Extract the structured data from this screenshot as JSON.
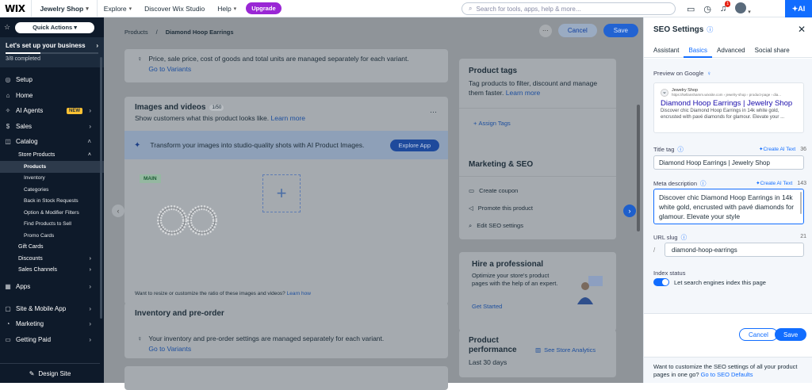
{
  "topbar": {
    "logo": "WIX",
    "site_name": "Jewelry Shop",
    "explore": "Explore",
    "discover": "Discover Wix Studio",
    "help": "Help",
    "upgrade": "Upgrade",
    "search_placeholder": "Search for tools, apps, help & more...",
    "notification_count": "1",
    "ai_label": "AI"
  },
  "sidebar": {
    "quick_actions": "Quick Actions",
    "setup_title": "Let's set up your business",
    "setup_progress_fraction": 0.375,
    "setup_status": "3/8 completed",
    "items": [
      {
        "label": "Setup",
        "icon": "setup-icon"
      },
      {
        "label": "Home",
        "icon": "home-icon"
      },
      {
        "label": "AI Agents",
        "icon": "ai-agents-icon",
        "badge": "NEW"
      },
      {
        "label": "Sales",
        "icon": "sales-icon"
      },
      {
        "label": "Catalog",
        "icon": "catalog-icon"
      }
    ],
    "catalog_sub": {
      "store_products": "Store Products",
      "store_children": [
        "Products",
        "Inventory",
        "Categories",
        "Back in Stock Requests",
        "Option & Modifier Filters",
        "Find Products to Sell",
        "Promo Cards"
      ],
      "gift_cards": "Gift Cards",
      "discounts": "Discounts",
      "sales_channels": "Sales Channels"
    },
    "bottom_items": [
      {
        "label": "Apps"
      },
      {
        "label": "Site & Mobile App"
      },
      {
        "label": "Marketing"
      },
      {
        "label": "Getting Paid"
      }
    ],
    "design_site": "Design Site"
  },
  "main": {
    "breadcrumb": [
      "Products",
      "Diamond Hoop Earrings"
    ],
    "cancel": "Cancel",
    "save": "Save",
    "variants_note": "Price, sale price, cost of goods and total units are managed separately for each variant.",
    "go_to_variants": "Go to Variants",
    "images_title": "Images and videos",
    "images_count": "1/50",
    "images_sub": "Show customers what this product looks like.",
    "learn_more": "Learn more",
    "ai_banner": "Transform your images into studio-quality shots with AI Product Images.",
    "explore_app": "Explore App",
    "main_badge": "MAIN",
    "resize_note": "Want to resize or customize the ratio of these images and videos?",
    "learn_how": "Learn how",
    "inventory_title": "Inventory and pre-order",
    "inventory_note": "Your inventory and pre-order settings are managed separately for each variant.",
    "product_tags_title": "Product tags",
    "product_tags_sub": "Tag products to filter, discount and manage them faster.",
    "assign_tags": "Assign Tags",
    "marketing_title": "Marketing & SEO",
    "marketing_items": [
      "Create coupon",
      "Promote this product",
      "Edit SEO settings"
    ],
    "hire_title": "Hire a professional",
    "hire_sub": "Optimize your store's product pages with the help of an expert.",
    "get_started": "Get Started",
    "perf_title_1": "Product",
    "perf_title_2": "performance",
    "perf_sub": "Last 30 days",
    "see_analytics": "See Store Analytics"
  },
  "panel": {
    "title": "SEO Settings",
    "tabs": [
      "Assistant",
      "Basics",
      "Advanced",
      "Social share"
    ],
    "active_tab": "Basics",
    "preview_label": "Preview on Google",
    "preview": {
      "site": "Jewelry Shop",
      "url": "https://kellanshamm.wixsite.com › jewelry-shop › product-page › dia...",
      "headline": "Diamond Hoop Earrings | Jewelry Shop",
      "desc": "Discover chic Diamond Hoop Earrings in 14k white gold, encrusted with pavé diamonds for glamour. Elevate your ..."
    },
    "title_tag_label": "Title tag",
    "create_ai_text": "Create AI Text",
    "title_count": "36",
    "title_value": "Diamond Hoop Earrings | Jewelry Shop",
    "meta_label": "Meta description",
    "meta_count": "143",
    "meta_value": "Discover chic Diamond Hoop Earrings in 14k white gold, encrusted with pavé diamonds for glamour. Elevate your style",
    "slug_label": "URL slug",
    "slug_count": "21",
    "slug_prefix": "/",
    "slug_value": "diamond-hoop-earrings",
    "index_label": "Index status",
    "index_toggle_label": "Let search engines index this page",
    "cancel": "Cancel",
    "save": "Save",
    "footer_text": "Want to customize the SEO settings of all your product pages in one go?",
    "footer_link": "Go to SEO Defaults"
  }
}
